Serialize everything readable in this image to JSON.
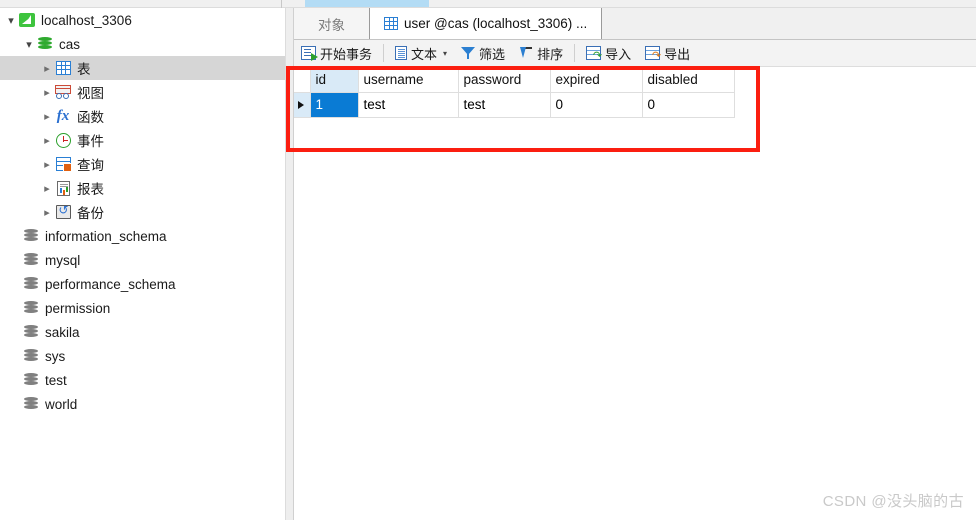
{
  "sidebar": {
    "connection": {
      "label": "localhost_3306",
      "icon": "mysql-dolphin-icon",
      "expanded": true
    },
    "database": {
      "label": "cas",
      "icon": "database-icon",
      "expanded": true
    },
    "objects": [
      {
        "label": "表",
        "icon": "table-icon",
        "selected": true
      },
      {
        "label": "视图",
        "icon": "view-icon",
        "selected": false
      },
      {
        "label": "函数",
        "icon": "function-icon",
        "selected": false
      },
      {
        "label": "事件",
        "icon": "event-clock-icon",
        "selected": false
      },
      {
        "label": "查询",
        "icon": "query-icon",
        "selected": false
      },
      {
        "label": "报表",
        "icon": "report-icon",
        "selected": false
      },
      {
        "label": "备份",
        "icon": "backup-icon",
        "selected": false
      }
    ],
    "databases": [
      {
        "label": "information_schema",
        "icon": "database-icon"
      },
      {
        "label": "mysql",
        "icon": "database-icon"
      },
      {
        "label": "performance_schema",
        "icon": "database-icon"
      },
      {
        "label": "permission",
        "icon": "database-icon"
      },
      {
        "label": "sakila",
        "icon": "database-icon"
      },
      {
        "label": "sys",
        "icon": "database-icon"
      },
      {
        "label": "test",
        "icon": "database-icon"
      },
      {
        "label": "world",
        "icon": "database-icon"
      }
    ]
  },
  "tabs": [
    {
      "label": "对象",
      "active": false,
      "icon": null
    },
    {
      "label": "user @cas (localhost_3306) ...",
      "active": true,
      "icon": "table-grid-icon"
    }
  ],
  "toolbar": {
    "begin_transaction": "开始事务",
    "text": "文本",
    "text_caret": "▾",
    "filter": "筛选",
    "sort": "排序",
    "import": "导入",
    "export": "导出"
  },
  "grid": {
    "columns": [
      "id",
      "username",
      "password",
      "expired",
      "disabled"
    ],
    "selected_column": "id",
    "rows": [
      {
        "indicator": "▶",
        "cells": [
          "1",
          "test",
          "test",
          "0",
          "0"
        ],
        "selected_cell_index": 0
      }
    ]
  },
  "annotation": {
    "color": "#fb1e10",
    "shape": "rectangle"
  },
  "watermark": {
    "text": "CSDN @没头脑的古"
  }
}
